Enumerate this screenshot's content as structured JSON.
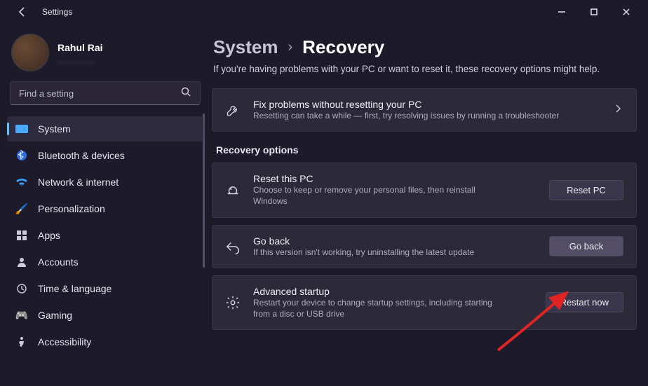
{
  "app": {
    "title": "Settings"
  },
  "window_controls": {
    "min": "–",
    "max": "▢",
    "close": "✕"
  },
  "account": {
    "name": "Rahul Rai",
    "email": "________"
  },
  "search": {
    "placeholder": "Find a setting"
  },
  "nav": [
    {
      "id": "system",
      "label": "System",
      "icon": "🖥️",
      "active": true
    },
    {
      "id": "bluetooth",
      "label": "Bluetooth & devices",
      "icon": "bt"
    },
    {
      "id": "network",
      "label": "Network & internet",
      "icon": "📶"
    },
    {
      "id": "personalization",
      "label": "Personalization",
      "icon": "🖌️"
    },
    {
      "id": "apps",
      "label": "Apps",
      "icon": "▦"
    },
    {
      "id": "accounts",
      "label": "Accounts",
      "icon": "👤"
    },
    {
      "id": "time",
      "label": "Time & language",
      "icon": "🕒"
    },
    {
      "id": "gaming",
      "label": "Gaming",
      "icon": "🎮"
    },
    {
      "id": "accessibility",
      "label": "Accessibility",
      "icon": "♿"
    }
  ],
  "breadcrumb": {
    "parent": "System",
    "current": "Recovery"
  },
  "subtitle": "If you're having problems with your PC or want to reset it, these recovery options might help.",
  "fix_card": {
    "title": "Fix problems without resetting your PC",
    "sub": "Resetting can take a while — first, try resolving issues by running a troubleshooter"
  },
  "section_label": "Recovery options",
  "recovery_cards": [
    {
      "id": "reset-pc",
      "title": "Reset this PC",
      "sub": "Choose to keep or remove your personal files, then reinstall Windows",
      "button": "Reset PC",
      "highlight": false
    },
    {
      "id": "go-back",
      "title": "Go back",
      "sub": "If this version isn't working, try uninstalling the latest update",
      "button": "Go back",
      "highlight": true
    },
    {
      "id": "advanced-startup",
      "title": "Advanced startup",
      "sub": "Restart your device to change startup settings, including starting from a disc or USB drive",
      "button": "Restart now",
      "highlight": false
    }
  ]
}
